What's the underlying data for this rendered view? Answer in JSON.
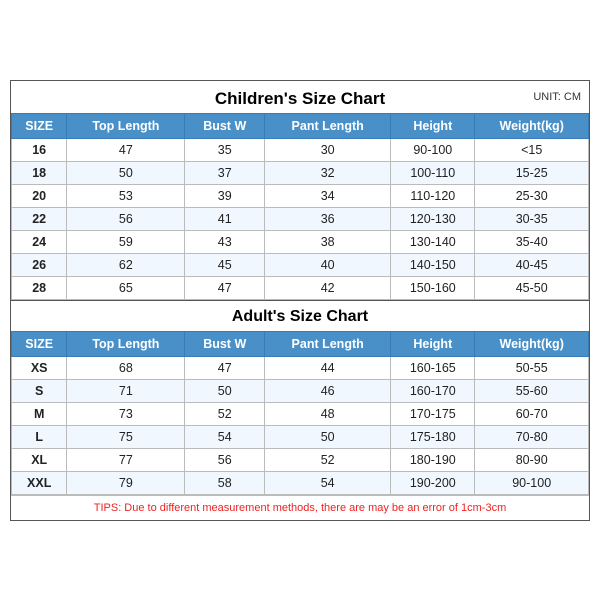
{
  "children_chart": {
    "title": "Children's Size Chart",
    "unit": "UNIT: CM",
    "headers": [
      "SIZE",
      "Top Length",
      "Bust W",
      "Pant Length",
      "Height",
      "Weight(kg)"
    ],
    "rows": [
      [
        "16",
        "47",
        "35",
        "30",
        "90-100",
        "<15"
      ],
      [
        "18",
        "50",
        "37",
        "32",
        "100-110",
        "15-25"
      ],
      [
        "20",
        "53",
        "39",
        "34",
        "110-120",
        "25-30"
      ],
      [
        "22",
        "56",
        "41",
        "36",
        "120-130",
        "30-35"
      ],
      [
        "24",
        "59",
        "43",
        "38",
        "130-140",
        "35-40"
      ],
      [
        "26",
        "62",
        "45",
        "40",
        "140-150",
        "40-45"
      ],
      [
        "28",
        "65",
        "47",
        "42",
        "150-160",
        "45-50"
      ]
    ]
  },
  "adult_chart": {
    "title": "Adult's Size Chart",
    "headers": [
      "SIZE",
      "Top Length",
      "Bust W",
      "Pant Length",
      "Height",
      "Weight(kg)"
    ],
    "rows": [
      [
        "XS",
        "68",
        "47",
        "44",
        "160-165",
        "50-55"
      ],
      [
        "S",
        "71",
        "50",
        "46",
        "160-170",
        "55-60"
      ],
      [
        "M",
        "73",
        "52",
        "48",
        "170-175",
        "60-70"
      ],
      [
        "L",
        "75",
        "54",
        "50",
        "175-180",
        "70-80"
      ],
      [
        "XL",
        "77",
        "56",
        "52",
        "180-190",
        "80-90"
      ],
      [
        "XXL",
        "79",
        "58",
        "54",
        "190-200",
        "90-100"
      ]
    ]
  },
  "tips": "TIPS: Due to different measurement methods, there are may be an error of 1cm-3cm"
}
